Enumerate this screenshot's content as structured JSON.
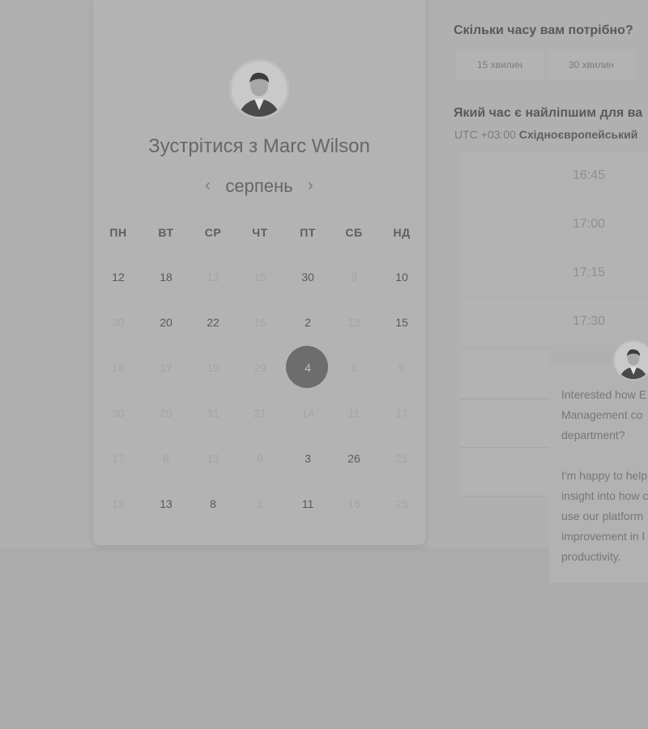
{
  "calendar": {
    "title": "Зустрітися з Marc Wilson",
    "month": "серпень",
    "prev_icon": "‹",
    "next_icon": "›",
    "weekdays": [
      "ПН",
      "ВТ",
      "СР",
      "ЧТ",
      "ПТ",
      "СБ",
      "НД"
    ],
    "weeks": [
      [
        {
          "d": "12",
          "s": "av"
        },
        {
          "d": "18",
          "s": "av"
        },
        {
          "d": "13",
          "s": "un"
        },
        {
          "d": "15",
          "s": "un"
        },
        {
          "d": "30",
          "s": "av"
        },
        {
          "d": "9",
          "s": "un"
        },
        {
          "d": "10",
          "s": "av"
        }
      ],
      [
        {
          "d": "30",
          "s": "un"
        },
        {
          "d": "20",
          "s": "av"
        },
        {
          "d": "22",
          "s": "av"
        },
        {
          "d": "15",
          "s": "un"
        },
        {
          "d": "2",
          "s": "av"
        },
        {
          "d": "13",
          "s": "un"
        },
        {
          "d": "15",
          "s": "av"
        }
      ],
      [
        {
          "d": "16",
          "s": "un"
        },
        {
          "d": "17",
          "s": "un"
        },
        {
          "d": "19",
          "s": "un"
        },
        {
          "d": "29",
          "s": "un"
        },
        {
          "d": "4",
          "s": "sel"
        },
        {
          "d": "6",
          "s": "un"
        },
        {
          "d": "9",
          "s": "un"
        }
      ],
      [
        {
          "d": "30",
          "s": "un"
        },
        {
          "d": "20",
          "s": "un"
        },
        {
          "d": "31",
          "s": "un"
        },
        {
          "d": "21",
          "s": "un"
        },
        {
          "d": "14",
          "s": "un"
        },
        {
          "d": "11",
          "s": "un"
        },
        {
          "d": "17",
          "s": "un"
        }
      ],
      [
        {
          "d": "17",
          "s": "un"
        },
        {
          "d": "8",
          "s": "un"
        },
        {
          "d": "13",
          "s": "un"
        },
        {
          "d": "9",
          "s": "un"
        },
        {
          "d": "3",
          "s": "av"
        },
        {
          "d": "26",
          "s": "av"
        },
        {
          "d": "21",
          "s": "un"
        }
      ],
      [
        {
          "d": "12",
          "s": "un"
        },
        {
          "d": "13",
          "s": "av"
        },
        {
          "d": "8",
          "s": "av"
        },
        {
          "d": "1",
          "s": "un"
        },
        {
          "d": "11",
          "s": "av"
        },
        {
          "d": "16",
          "s": "un"
        },
        {
          "d": "25",
          "s": "un"
        }
      ]
    ]
  },
  "duration": {
    "question": "Скільки часу вам потрібно?",
    "options": [
      "15 хвилин",
      "30 хвилин"
    ]
  },
  "time": {
    "question": "Який час є найліпшим для ва",
    "tz_offset": "UTC +03:00",
    "tz_name": "Східноєвропейський",
    "slots": [
      "16:45",
      "17:00",
      "17:15",
      "17:30"
    ]
  },
  "chat": {
    "lines": [
      "Interested how E",
      "Management co",
      "department?",
      "",
      "I'm happy to help",
      "insight into how c",
      "use our platform",
      "improvement in l",
      "productivity."
    ]
  },
  "colors": {
    "selected_day": "#6d6d6d",
    "background": "#ababab"
  }
}
